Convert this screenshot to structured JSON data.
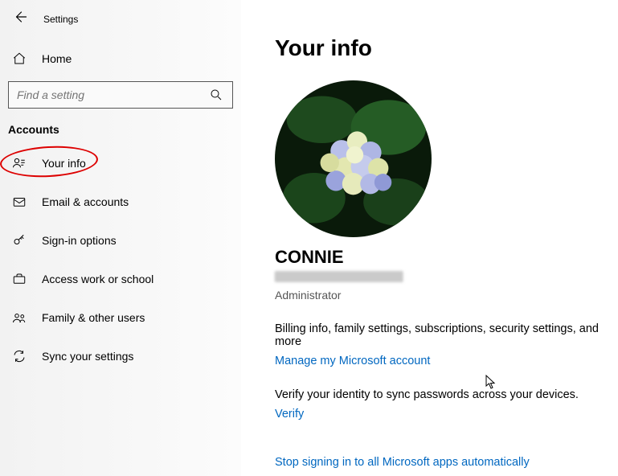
{
  "app_title": "Settings",
  "home_label": "Home",
  "search_placeholder": "Find a setting",
  "section_title": "Accounts",
  "nav": [
    {
      "label": "Your info"
    },
    {
      "label": "Email & accounts"
    },
    {
      "label": "Sign-in options"
    },
    {
      "label": "Access work or school"
    },
    {
      "label": "Family & other users"
    },
    {
      "label": "Sync your settings"
    }
  ],
  "page": {
    "title": "Your info",
    "username": "CONNIE",
    "role": "Administrator",
    "billing_text": "Billing info, family settings, subscriptions, security settings, and more",
    "manage_link": "Manage my Microsoft account",
    "verify_text": "Verify your identity to sync passwords across your devices.",
    "verify_link": "Verify",
    "stop_link": "Stop signing in to all Microsoft apps automatically"
  }
}
